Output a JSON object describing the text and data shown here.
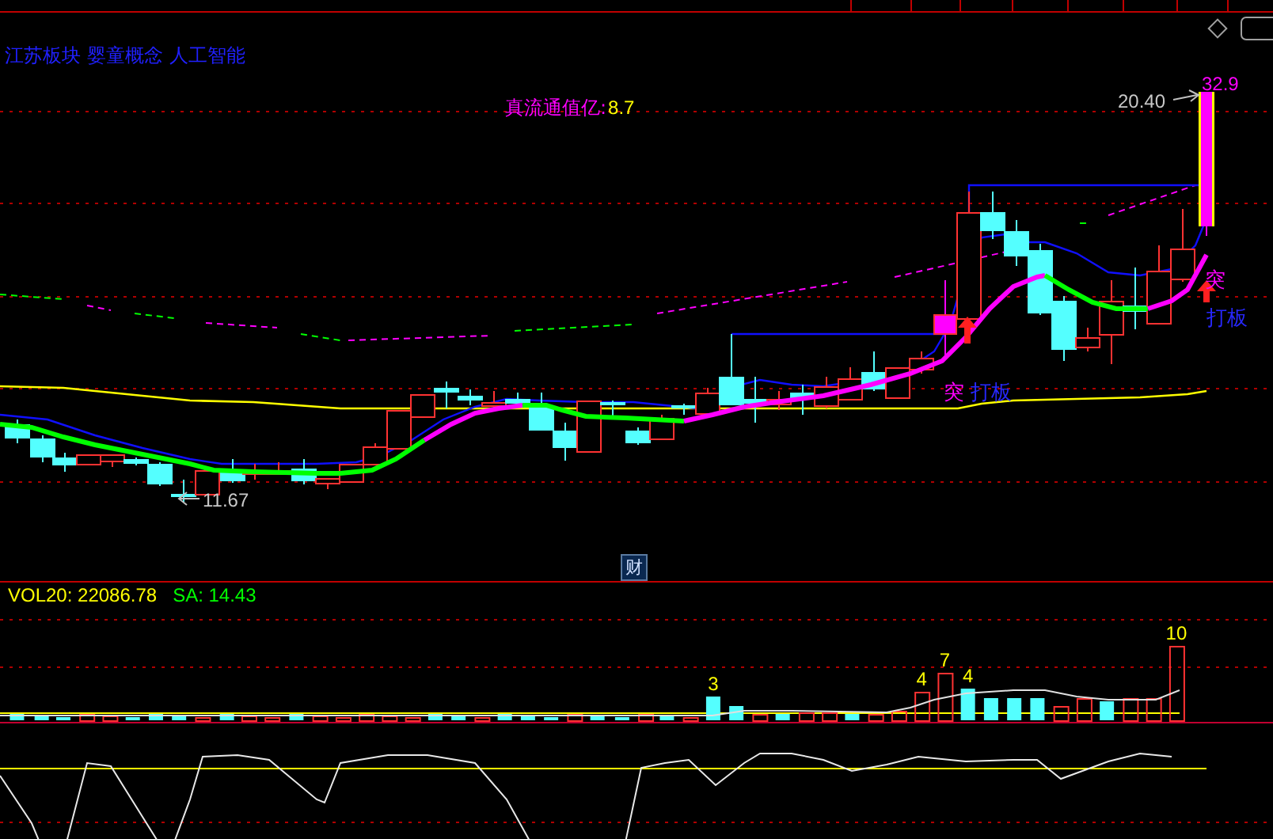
{
  "sectors": [
    "江苏板块",
    "婴童概念",
    "人工智能"
  ],
  "float_cap": {
    "label": "真流通值亿:",
    "value": "8.7"
  },
  "price_chart": {
    "high_marker": "20.40",
    "limit_label": "32.9",
    "low_marker": "11.67",
    "signals": [
      {
        "breakout": "突",
        "board_call": "打板"
      },
      {
        "breakout": "突",
        "board_call": "打板"
      }
    ],
    "finance_badge": "财"
  },
  "volume_panel": {
    "indicators": [
      {
        "text": "VOL20: 22086.78",
        "color": "#ffff00"
      },
      {
        "text": "SA: 14.43",
        "color": "#00ff00"
      }
    ],
    "bar_labels": [
      "3",
      "4",
      "7",
      "4",
      "10"
    ]
  }
}
